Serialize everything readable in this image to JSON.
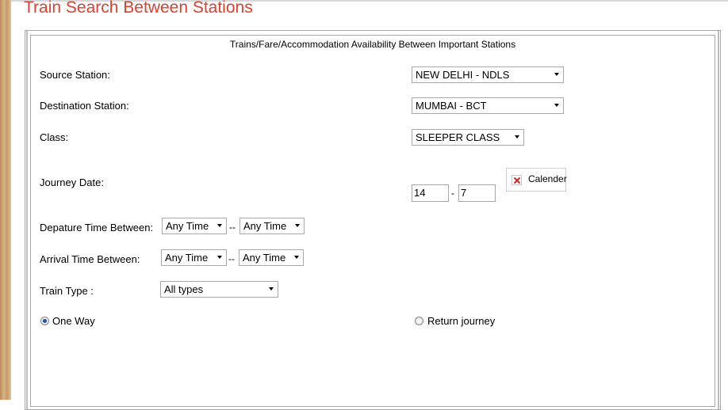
{
  "page": {
    "title": "Train Search Between Stations",
    "subtitle": "Trains/Fare/Accommodation Availability Between Important Stations"
  },
  "form": {
    "source": {
      "label": "Source Station:",
      "value": "NEW DELHI - NDLS"
    },
    "destination": {
      "label": "Destination Station:",
      "value": "MUMBAI - BCT"
    },
    "class": {
      "label": "Class:",
      "value": "SLEEPER CLASS"
    },
    "journey_date": {
      "label": "Journey Date:",
      "day": "14",
      "separator": "-",
      "month": "7",
      "calendar_label": "Calender"
    },
    "departure_time": {
      "label": "Depature Time Between:",
      "from": "Any Time",
      "separator": "--",
      "to": "Any Time"
    },
    "arrival_time": {
      "label": "Arrival Time Between:",
      "from": "Any Time",
      "separator": "--",
      "to": "Any Time"
    },
    "train_type": {
      "label": "Train Type :",
      "value": "All types"
    },
    "trip": {
      "one_way_label": "One Way",
      "return_label": "Return journey",
      "selected": "one_way"
    }
  },
  "colors": {
    "title": "#e0402e",
    "border": "#a8a8a8",
    "radio_dot": "#1f4f9a",
    "calendar_x": "#d42020"
  },
  "icons": {
    "calendar": "broken-image-x-icon",
    "dropdown": "chevron-down-icon"
  }
}
